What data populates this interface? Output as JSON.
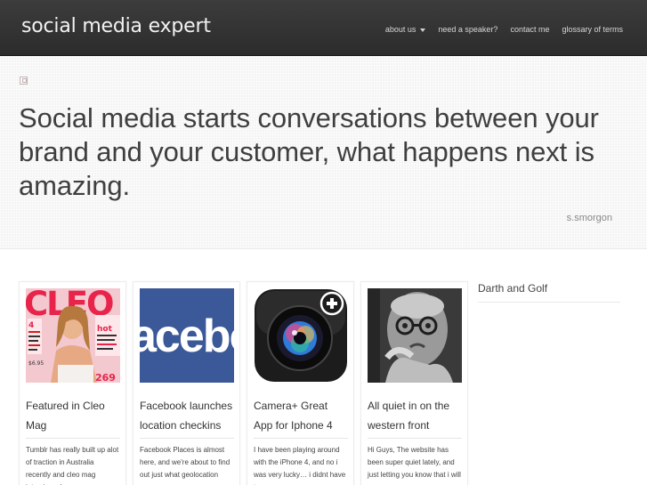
{
  "header": {
    "logo": "social media expert",
    "nav": [
      {
        "label": "about us",
        "has_dropdown": true
      },
      {
        "label": "need a speaker?",
        "has_dropdown": false
      },
      {
        "label": "contact me",
        "has_dropdown": false
      },
      {
        "label": "glossary of terms",
        "has_dropdown": false
      }
    ]
  },
  "hero": {
    "quote": "Social media starts conversations between your brand and your customer, what happens next is amazing.",
    "author": "s.smorgon"
  },
  "posts": [
    {
      "title": "Featured in Cleo Mag",
      "excerpt": "Tumblr has really built up alot of traction in Australia recently and cleo mag interviewed me",
      "thumbnail": "cleo-magazine-cover",
      "cover": {
        "masthead": "CLEO",
        "price": "$6.95",
        "issue": "269"
      }
    },
    {
      "title": "Facebook launches location checkins",
      "excerpt": "Facebook Places is almost here, and we're about to find out just what geolocation",
      "thumbnail": "facebook-logo",
      "logo_text": "acebo"
    },
    {
      "title": "Camera+ Great App for Iphone 4",
      "excerpt": "I have been playing around with the iPhone 4, and no i was very lucky… i didnt have to",
      "thumbnail": "camera-plus-app-icon"
    },
    {
      "title": "All quiet in on the western front",
      "excerpt": "Hi Guys, The website has been super quiet lately, and just letting you know that i will",
      "thumbnail": "elderly-man-photo"
    }
  ],
  "sidebar": {
    "title": "Darth and Golf"
  },
  "colors": {
    "header_bg": "#333333",
    "hero_bg": "#f4f4f4",
    "facebook_blue": "#3b5998"
  }
}
